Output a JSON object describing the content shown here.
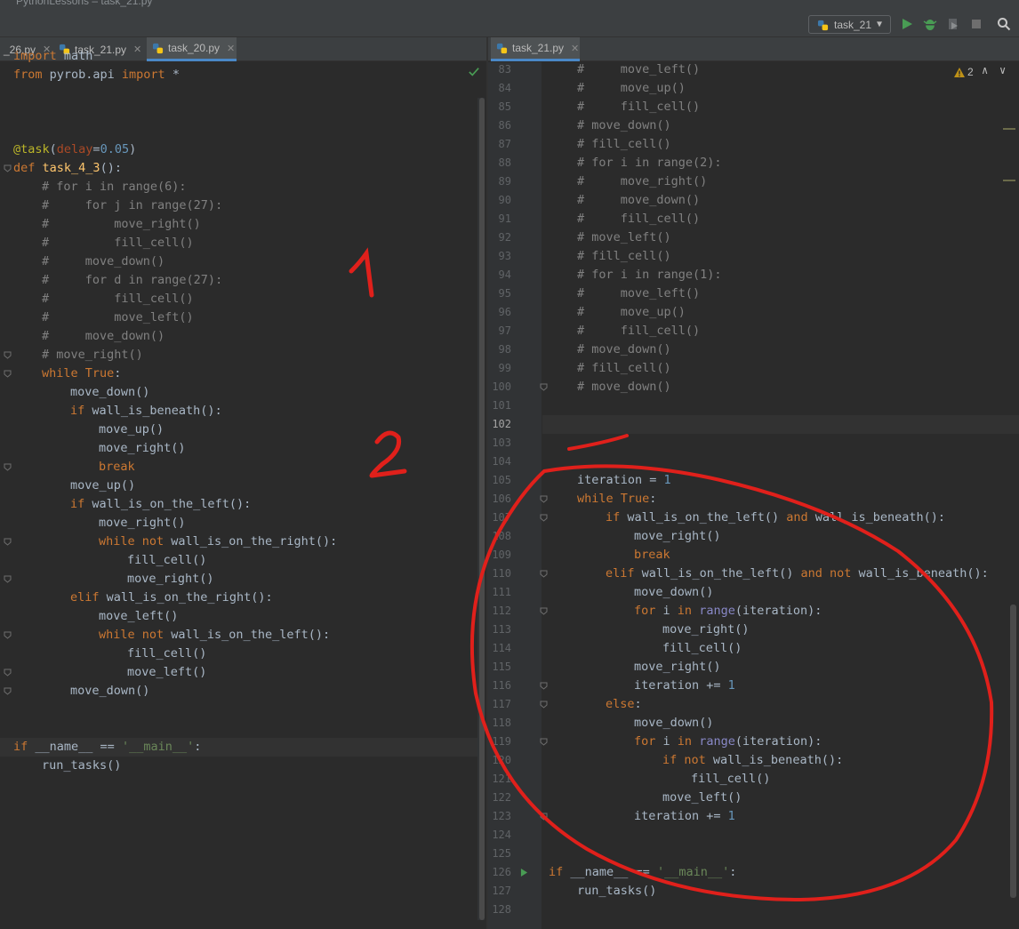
{
  "window": {
    "title": "PythonLessons – task_21.py"
  },
  "toolbar": {
    "run_config": "task_21",
    "icons": [
      "run-icon",
      "debug-icon",
      "coverage-icon",
      "stop-icon",
      "search-icon"
    ]
  },
  "left_tabs": [
    {
      "label": "_26.py"
    },
    {
      "label": "task_21.py"
    },
    {
      "label": "task_20.py",
      "active": true
    }
  ],
  "right_tabs": [
    {
      "label": "task_21.py",
      "active": true
    }
  ],
  "right_status": {
    "warnings": "2"
  },
  "left_code": [
    {
      "indent": 0,
      "text": "import",
      "parts": [
        [
          "kw",
          "import"
        ],
        [
          "",
          " math"
        ]
      ]
    },
    {
      "indent": 0,
      "parts": [
        [
          "kw",
          "from"
        ],
        [
          "",
          " pyrob.api "
        ],
        [
          "kw",
          "import"
        ],
        [
          "",
          " *"
        ]
      ]
    },
    {
      "indent": 0,
      "parts": []
    },
    {
      "indent": 0,
      "parts": []
    },
    {
      "indent": 0,
      "parts": []
    },
    {
      "indent": 0,
      "parts": [
        [
          "deco",
          "@task"
        ],
        [
          "",
          "("
        ],
        [
          "param",
          "delay"
        ],
        [
          "",
          "="
        ],
        [
          "num",
          "0.05"
        ],
        [
          "",
          ")"
        ]
      ]
    },
    {
      "indent": 0,
      "parts": [
        [
          "kw",
          "def"
        ],
        [
          "",
          " "
        ],
        [
          "fn",
          "task_4_3"
        ],
        [
          "",
          "():"
        ]
      ]
    },
    {
      "indent": 1,
      "parts": [
        [
          "com",
          "# for i in range(6):"
        ]
      ]
    },
    {
      "indent": 1,
      "parts": [
        [
          "com",
          "#     for j in range(27):"
        ]
      ]
    },
    {
      "indent": 1,
      "parts": [
        [
          "com",
          "#         move_right()"
        ]
      ]
    },
    {
      "indent": 1,
      "parts": [
        [
          "com",
          "#         fill_cell()"
        ]
      ]
    },
    {
      "indent": 1,
      "parts": [
        [
          "com",
          "#     move_down()"
        ]
      ]
    },
    {
      "indent": 1,
      "parts": [
        [
          "com",
          "#     for d in range(27):"
        ]
      ]
    },
    {
      "indent": 1,
      "parts": [
        [
          "com",
          "#         fill_cell()"
        ]
      ]
    },
    {
      "indent": 1,
      "parts": [
        [
          "com",
          "#         move_left()"
        ]
      ]
    },
    {
      "indent": 1,
      "parts": [
        [
          "com",
          "#     move_down()"
        ]
      ]
    },
    {
      "indent": 1,
      "parts": [
        [
          "com",
          "# move_right()"
        ]
      ]
    },
    {
      "indent": 1,
      "parts": [
        [
          "kw",
          "while"
        ],
        [
          "",
          " "
        ],
        [
          "kw",
          "True"
        ],
        [
          "",
          ":"
        ]
      ]
    },
    {
      "indent": 2,
      "parts": [
        [
          "",
          "move_down()"
        ]
      ]
    },
    {
      "indent": 2,
      "parts": [
        [
          "kw",
          "if"
        ],
        [
          "",
          " wall_is_beneath():"
        ]
      ]
    },
    {
      "indent": 3,
      "parts": [
        [
          "",
          "move_up()"
        ]
      ]
    },
    {
      "indent": 3,
      "parts": [
        [
          "",
          "move_right()"
        ]
      ]
    },
    {
      "indent": 3,
      "parts": [
        [
          "kw",
          "break"
        ]
      ]
    },
    {
      "indent": 2,
      "parts": [
        [
          "",
          "move_up()"
        ]
      ]
    },
    {
      "indent": 2,
      "parts": [
        [
          "kw",
          "if"
        ],
        [
          "",
          " wall_is_on_the_left():"
        ]
      ]
    },
    {
      "indent": 3,
      "parts": [
        [
          "",
          "move_right()"
        ]
      ]
    },
    {
      "indent": 3,
      "parts": [
        [
          "kw",
          "while not"
        ],
        [
          "",
          " wall_is_on_the_right():"
        ]
      ]
    },
    {
      "indent": 4,
      "parts": [
        [
          "",
          "fill_cell()"
        ]
      ]
    },
    {
      "indent": 4,
      "parts": [
        [
          "",
          "move_right()"
        ]
      ]
    },
    {
      "indent": 2,
      "parts": [
        [
          "kw",
          "elif"
        ],
        [
          "",
          " wall_is_on_the_right():"
        ]
      ]
    },
    {
      "indent": 3,
      "parts": [
        [
          "",
          "move_left()"
        ]
      ]
    },
    {
      "indent": 3,
      "parts": [
        [
          "kw",
          "while not"
        ],
        [
          "",
          " wall_is_on_the_left():"
        ]
      ]
    },
    {
      "indent": 4,
      "parts": [
        [
          "",
          "fill_cell()"
        ]
      ]
    },
    {
      "indent": 4,
      "parts": [
        [
          "",
          "move_left()"
        ]
      ]
    },
    {
      "indent": 2,
      "parts": [
        [
          "",
          "move_down()"
        ]
      ]
    },
    {
      "indent": 0,
      "parts": []
    },
    {
      "indent": 0,
      "parts": []
    },
    {
      "indent": 0,
      "parts": [
        [
          "kw",
          "if"
        ],
        [
          "",
          " __name__ == "
        ],
        [
          "str",
          "'__main__'"
        ],
        [
          "",
          ":"
        ]
      ]
    },
    {
      "indent": 1,
      "parts": [
        [
          "",
          "run_tasks()"
        ]
      ]
    }
  ],
  "right_code": [
    {
      "num": "83",
      "indent": 1,
      "parts": [
        [
          "com",
          "#     move_left()"
        ]
      ]
    },
    {
      "num": "84",
      "indent": 1,
      "parts": [
        [
          "com",
          "#     move_up()"
        ]
      ]
    },
    {
      "num": "85",
      "indent": 1,
      "parts": [
        [
          "com",
          "#     fill_cell()"
        ]
      ]
    },
    {
      "num": "86",
      "indent": 1,
      "parts": [
        [
          "com",
          "# move_down()"
        ]
      ]
    },
    {
      "num": "87",
      "indent": 1,
      "parts": [
        [
          "com",
          "# fill_cell()"
        ]
      ]
    },
    {
      "num": "88",
      "indent": 1,
      "parts": [
        [
          "com",
          "# for i in range(2):"
        ]
      ]
    },
    {
      "num": "89",
      "indent": 1,
      "parts": [
        [
          "com",
          "#     move_right()"
        ]
      ]
    },
    {
      "num": "90",
      "indent": 1,
      "parts": [
        [
          "com",
          "#     move_down()"
        ]
      ]
    },
    {
      "num": "91",
      "indent": 1,
      "parts": [
        [
          "com",
          "#     fill_cell()"
        ]
      ]
    },
    {
      "num": "92",
      "indent": 1,
      "parts": [
        [
          "com",
          "# move_left()"
        ]
      ]
    },
    {
      "num": "93",
      "indent": 1,
      "parts": [
        [
          "com",
          "# fill_cell()"
        ]
      ]
    },
    {
      "num": "94",
      "indent": 1,
      "parts": [
        [
          "com",
          "# for i in range(1):"
        ]
      ]
    },
    {
      "num": "95",
      "indent": 1,
      "parts": [
        [
          "com",
          "#     move_left()"
        ]
      ]
    },
    {
      "num": "96",
      "indent": 1,
      "parts": [
        [
          "com",
          "#     move_up()"
        ]
      ]
    },
    {
      "num": "97",
      "indent": 1,
      "parts": [
        [
          "com",
          "#     fill_cell()"
        ]
      ]
    },
    {
      "num": "98",
      "indent": 1,
      "parts": [
        [
          "com",
          "# move_down()"
        ]
      ]
    },
    {
      "num": "99",
      "indent": 1,
      "parts": [
        [
          "com",
          "# fill_cell()"
        ]
      ]
    },
    {
      "num": "100",
      "indent": 1,
      "parts": [
        [
          "com",
          "# move_down()"
        ]
      ]
    },
    {
      "num": "101",
      "indent": 0,
      "parts": []
    },
    {
      "num": "102",
      "indent": 0,
      "parts": []
    },
    {
      "num": "103",
      "indent": 0,
      "parts": []
    },
    {
      "num": "104",
      "indent": 0,
      "parts": []
    },
    {
      "num": "105",
      "indent": 1,
      "parts": [
        [
          "",
          "iteration = "
        ],
        [
          "num",
          "1"
        ]
      ]
    },
    {
      "num": "106",
      "indent": 1,
      "parts": [
        [
          "kw",
          "while"
        ],
        [
          "",
          " "
        ],
        [
          "kw",
          "True"
        ],
        [
          "",
          ":"
        ]
      ]
    },
    {
      "num": "107",
      "indent": 2,
      "parts": [
        [
          "kw",
          "if"
        ],
        [
          "",
          " wall_is_on_the_left() "
        ],
        [
          "kw",
          "and"
        ],
        [
          "",
          " wall_is_beneath():"
        ]
      ]
    },
    {
      "num": "108",
      "indent": 3,
      "parts": [
        [
          "",
          "move_right()"
        ]
      ]
    },
    {
      "num": "109",
      "indent": 3,
      "parts": [
        [
          "kw",
          "break"
        ]
      ]
    },
    {
      "num": "110",
      "indent": 2,
      "parts": [
        [
          "kw",
          "elif"
        ],
        [
          "",
          " wall_is_on_the_left() "
        ],
        [
          "kw",
          "and not"
        ],
        [
          "",
          " wall_is_beneath():"
        ]
      ]
    },
    {
      "num": "111",
      "indent": 3,
      "parts": [
        [
          "",
          "move_down()"
        ]
      ]
    },
    {
      "num": "112",
      "indent": 3,
      "parts": [
        [
          "kw",
          "for"
        ],
        [
          "",
          " i "
        ],
        [
          "kw",
          "in"
        ],
        [
          "",
          " "
        ],
        [
          "builtin",
          "range"
        ],
        [
          "",
          "(iteration):"
        ]
      ]
    },
    {
      "num": "113",
      "indent": 4,
      "parts": [
        [
          "",
          "move_right()"
        ]
      ]
    },
    {
      "num": "114",
      "indent": 4,
      "parts": [
        [
          "",
          "fill_cell()"
        ]
      ]
    },
    {
      "num": "115",
      "indent": 3,
      "parts": [
        [
          "",
          "move_right()"
        ]
      ]
    },
    {
      "num": "116",
      "indent": 3,
      "parts": [
        [
          "",
          "iteration += "
        ],
        [
          "num",
          "1"
        ]
      ]
    },
    {
      "num": "117",
      "indent": 2,
      "parts": [
        [
          "kw",
          "else"
        ],
        [
          "",
          ":"
        ]
      ]
    },
    {
      "num": "118",
      "indent": 3,
      "parts": [
        [
          "",
          "move_down()"
        ]
      ]
    },
    {
      "num": "119",
      "indent": 3,
      "parts": [
        [
          "kw",
          "for"
        ],
        [
          "",
          " i "
        ],
        [
          "kw",
          "in"
        ],
        [
          "",
          " "
        ],
        [
          "builtin",
          "range"
        ],
        [
          "",
          "(iteration):"
        ]
      ]
    },
    {
      "num": "120",
      "indent": 4,
      "parts": [
        [
          "kw",
          "if not"
        ],
        [
          "",
          " wall_is_beneath():"
        ]
      ]
    },
    {
      "num": "121",
      "indent": 5,
      "parts": [
        [
          "",
          "fill_cell()"
        ]
      ]
    },
    {
      "num": "122",
      "indent": 4,
      "parts": [
        [
          "",
          "move_left()"
        ]
      ]
    },
    {
      "num": "123",
      "indent": 3,
      "parts": [
        [
          "",
          "iteration += "
        ],
        [
          "num",
          "1"
        ]
      ]
    },
    {
      "num": "124",
      "indent": 0,
      "parts": []
    },
    {
      "num": "125",
      "indent": 0,
      "parts": []
    },
    {
      "num": "126",
      "indent": 0,
      "parts": [
        [
          "kw",
          "if"
        ],
        [
          "",
          " __name__ == "
        ],
        [
          "str",
          "'__main__'"
        ],
        [
          "",
          ":"
        ]
      ]
    },
    {
      "num": "127",
      "indent": 1,
      "parts": [
        [
          "",
          "run_tasks()"
        ]
      ]
    },
    {
      "num": "128",
      "indent": 0,
      "parts": []
    }
  ],
  "annotations": {
    "label_1": "1",
    "label_2": "2",
    "stroke_color": "#e0201b"
  },
  "colors": {
    "keyword": "#cc7832",
    "function": "#ffc66d",
    "number": "#6897bb",
    "string": "#6a8759",
    "comment": "#808080",
    "accent": "#4a88c7"
  }
}
